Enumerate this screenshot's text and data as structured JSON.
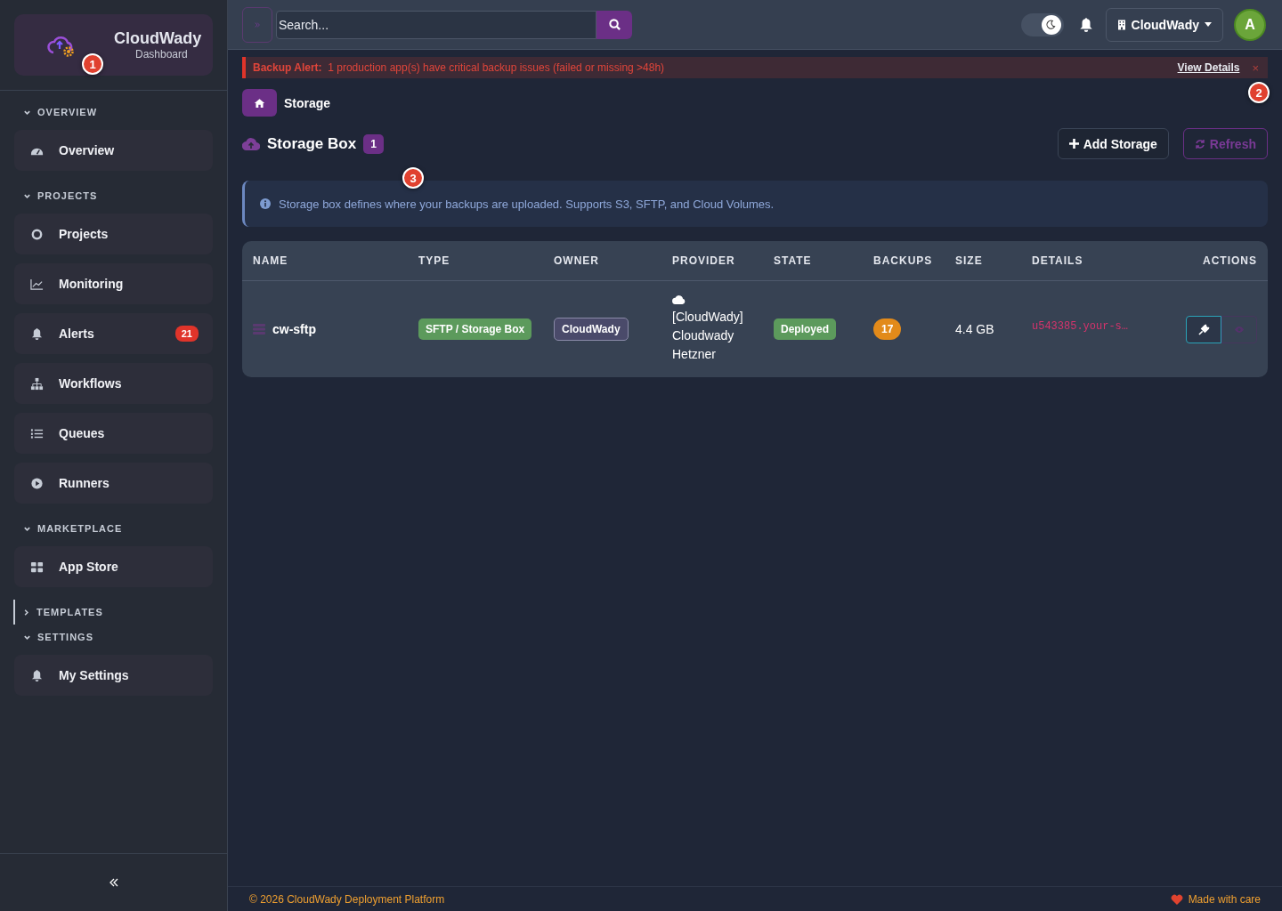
{
  "brand": {
    "name": "CloudWady",
    "subtitle": "Dashboard"
  },
  "sidebar": {
    "sections": [
      {
        "title": "OVERVIEW",
        "expanded": true,
        "items": [
          {
            "label": "Overview",
            "kind": "gauge"
          }
        ]
      },
      {
        "title": "PROJECTS",
        "expanded": true,
        "items": [
          {
            "label": "Projects",
            "kind": "circle"
          },
          {
            "label": "Monitoring",
            "kind": "chart"
          },
          {
            "label": "Alerts",
            "kind": "bell",
            "badge": "21"
          },
          {
            "label": "Workflows",
            "kind": "sitemap"
          },
          {
            "label": "Queues",
            "kind": "list"
          },
          {
            "label": "Runners",
            "kind": "play"
          }
        ]
      },
      {
        "title": "MARKETPLACE",
        "expanded": true,
        "items": [
          {
            "label": "App Store",
            "kind": "grid"
          }
        ]
      },
      {
        "title": "TEMPLATES",
        "expanded": false
      },
      {
        "title": "SETTINGS",
        "expanded": true,
        "items": [
          {
            "label": "My Settings",
            "kind": "bell"
          }
        ]
      }
    ]
  },
  "topbar": {
    "search": {
      "placeholder": "Search..."
    },
    "dark_mode": true,
    "org": "CloudWady",
    "avatar": "A"
  },
  "alert": {
    "title": "Backup Alert:",
    "message": "1 production app(s) have critical backup issues (failed or missing >48h)",
    "link": "View Details",
    "close": "×"
  },
  "breadcrumb": "Storage",
  "page": {
    "title": "Storage Box",
    "count": "1",
    "buttons": [
      {
        "label": "Add Storage",
        "kind": "add",
        "disabled": false
      },
      {
        "label": "Refresh",
        "kind": "refresh",
        "disabled": true
      }
    ]
  },
  "info": "Storage box defines where your backups are uploaded. Supports S3, SFTP, and Cloud Volumes.",
  "table": {
    "columns": [
      "NAME",
      "TYPE",
      "OWNER",
      "PROVIDER",
      "STATE",
      "BACKUPS",
      "SIZE",
      "DETAILS",
      "ACTIONS"
    ],
    "rows": [
      {
        "name": "cw-sftp",
        "type": "SFTP / Storage Box",
        "owner": "CloudWady",
        "provider": [
          "[CloudWady]",
          "Cloudwady",
          "Hetzner"
        ],
        "state": "Deployed",
        "backups": "17",
        "size": "4.4 GB",
        "details": "u543385.your-s…",
        "actions": [
          {
            "kind": "connect",
            "disabled": false
          },
          {
            "kind": "view",
            "disabled": true
          }
        ]
      }
    ]
  },
  "footer": {
    "copyright": "© 2026 CloudWady Deployment Platform",
    "made": "Made with care"
  },
  "markers": [
    {
      "label": "1"
    },
    {
      "label": "2"
    },
    {
      "label": "3"
    }
  ]
}
